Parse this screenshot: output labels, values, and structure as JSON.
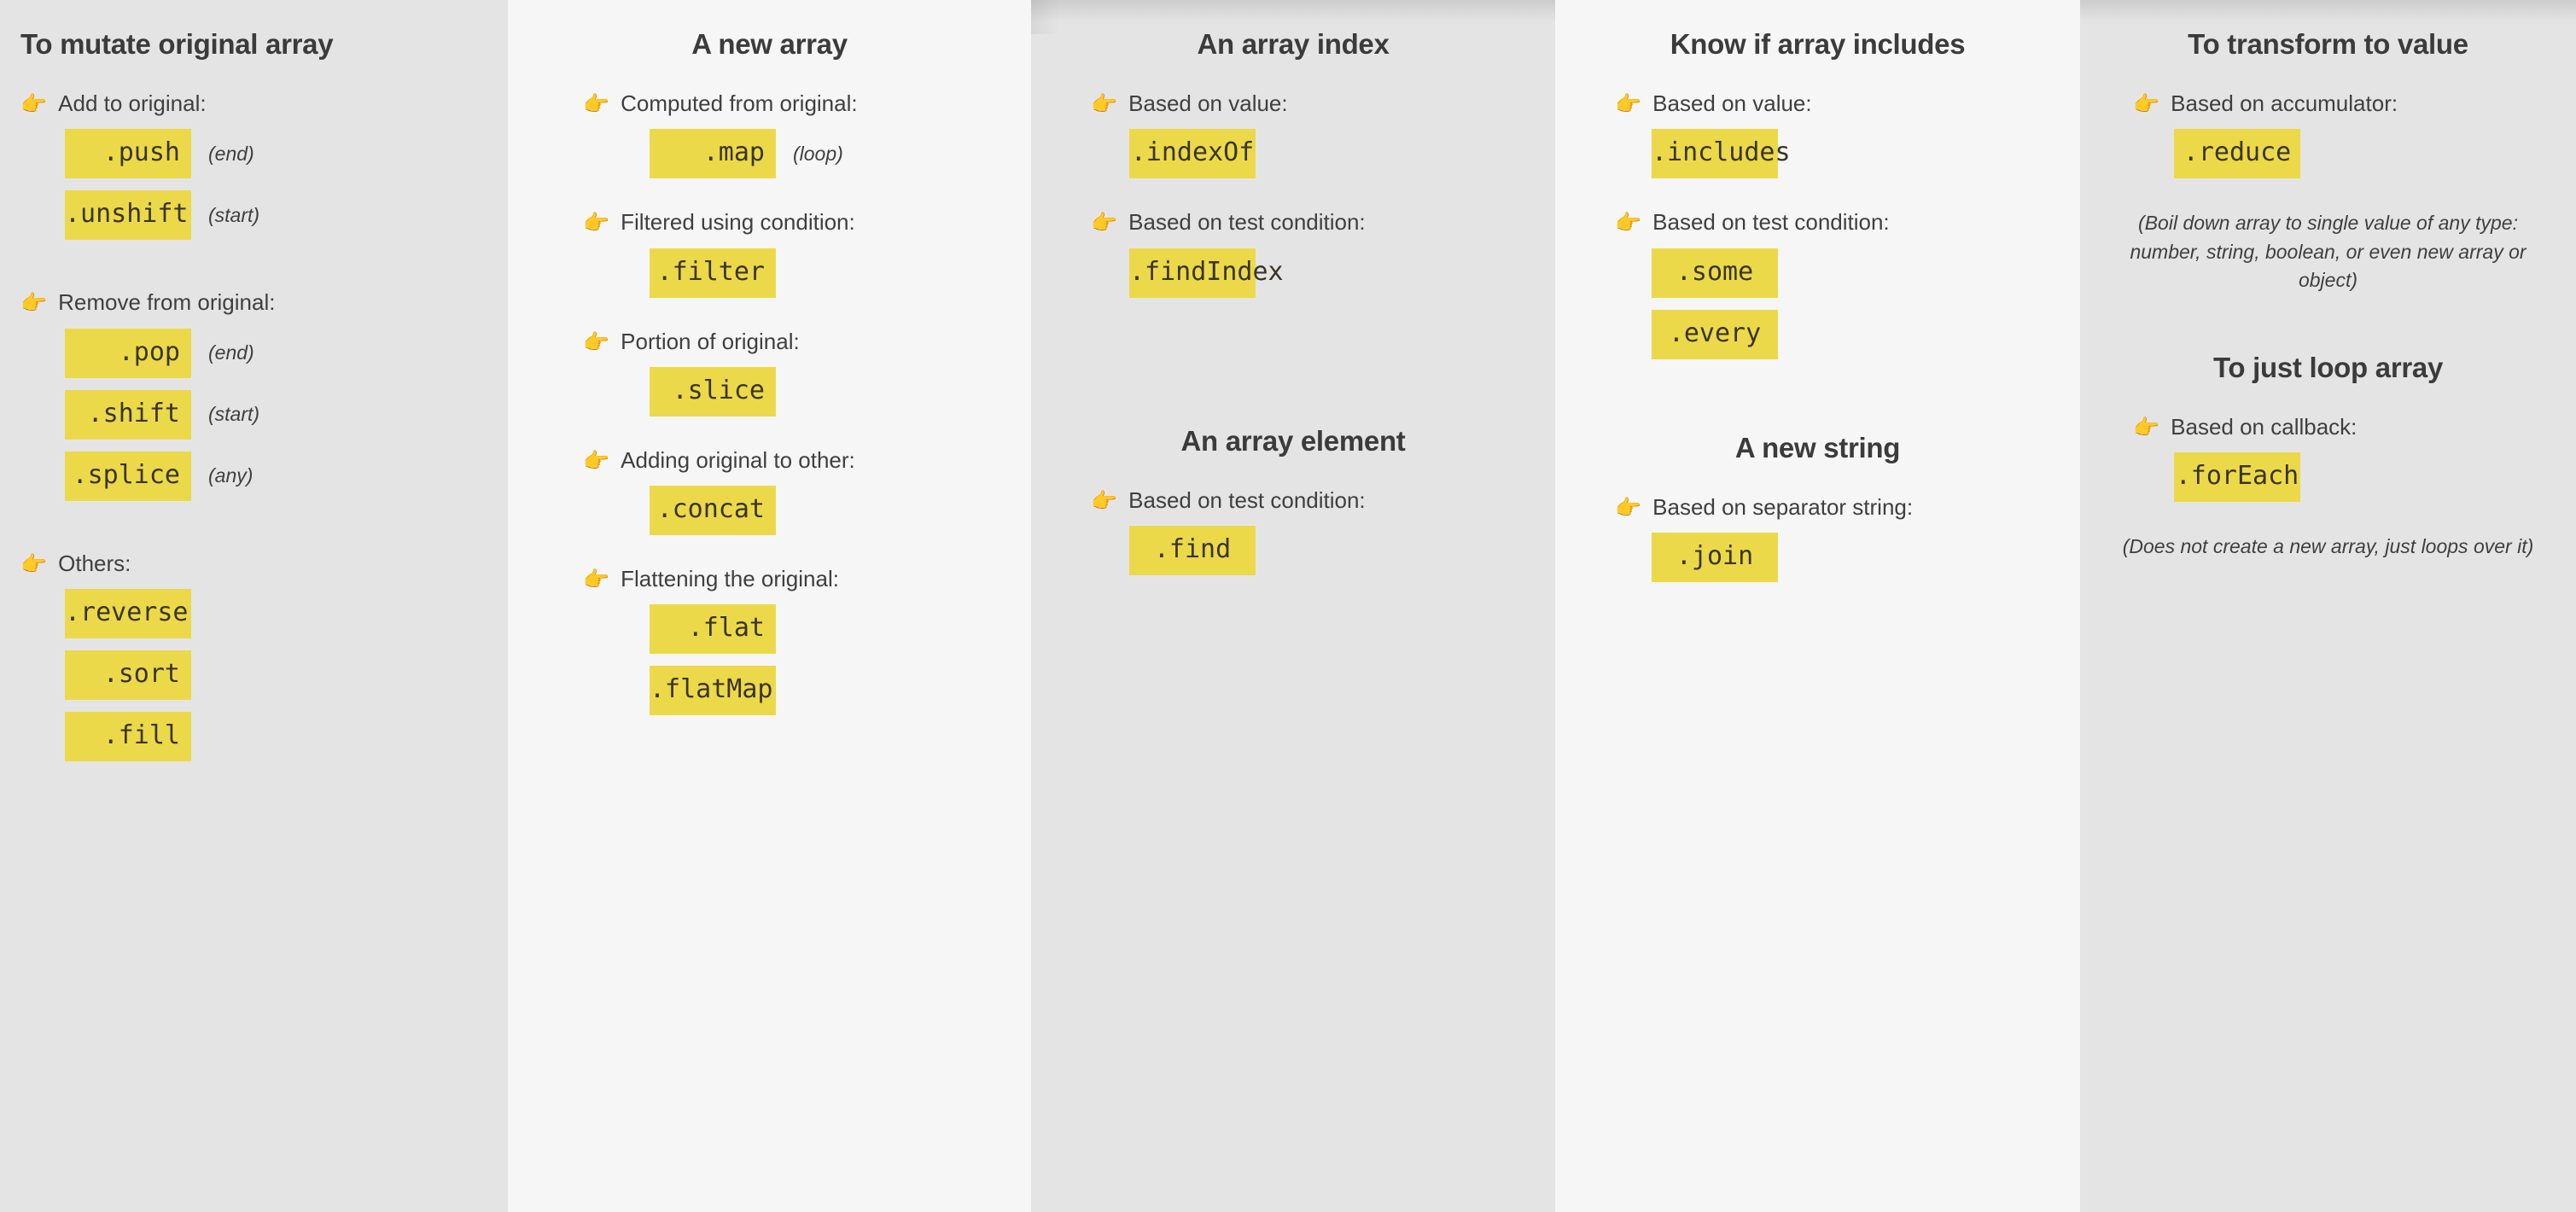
{
  "icons": {
    "hand_pointer": "👉"
  },
  "colors": {
    "panel_dark": "#e5e4e4",
    "panel_light": "#f6f6f6",
    "chip_yellow": "#ecd94a",
    "text_dark": "#3b3b3b"
  },
  "columns": [
    {
      "heading": "To mutate original array",
      "groups": [
        {
          "label": "Add to original:",
          "chips": [
            {
              "name": ".push",
              "note": "(end)"
            },
            {
              "name": ".unshift",
              "note": "(start)"
            }
          ]
        },
        {
          "label": "Remove from original:",
          "chips": [
            {
              "name": ".pop",
              "note": "(end)"
            },
            {
              "name": ".shift",
              "note": "(start)"
            },
            {
              "name": ".splice",
              "note": "(any)"
            }
          ]
        },
        {
          "label": "Others:",
          "chips": [
            {
              "name": ".reverse",
              "note": ""
            },
            {
              "name": ".sort",
              "note": ""
            },
            {
              "name": ".fill",
              "note": ""
            }
          ]
        }
      ]
    },
    {
      "heading": "A new array",
      "groups": [
        {
          "label": "Computed from original:",
          "chips": [
            {
              "name": ".map",
              "note": "(loop)"
            }
          ]
        },
        {
          "label": "Filtered using condition:",
          "chips": [
            {
              "name": ".filter",
              "note": ""
            }
          ]
        },
        {
          "label": "Portion of original:",
          "chips": [
            {
              "name": ".slice",
              "note": ""
            }
          ]
        },
        {
          "label": "Adding original to other:",
          "chips": [
            {
              "name": ".concat",
              "note": ""
            }
          ]
        },
        {
          "label": "Flattening the original:",
          "chips": [
            {
              "name": ".flat",
              "note": ""
            },
            {
              "name": ".flatMap",
              "note": ""
            }
          ]
        }
      ]
    },
    {
      "heading": "An array index",
      "groups": [
        {
          "label": "Based on value:",
          "chips": [
            {
              "name": ".indexOf",
              "note": ""
            }
          ]
        },
        {
          "label": "Based on test condition:",
          "chips": [
            {
              "name": ".findIndex",
              "note": ""
            }
          ]
        }
      ],
      "heading2": "An array element",
      "groups2": [
        {
          "label": "Based on test condition:",
          "chips": [
            {
              "name": ".find",
              "note": ""
            }
          ]
        }
      ]
    },
    {
      "heading": "Know if array includes",
      "groups": [
        {
          "label": "Based on value:",
          "chips": [
            {
              "name": ".includes",
              "note": ""
            }
          ]
        },
        {
          "label": "Based on test condition:",
          "chips": [
            {
              "name": ".some",
              "note": ""
            },
            {
              "name": ".every",
              "note": ""
            }
          ]
        }
      ],
      "heading2": "A new string",
      "groups2": [
        {
          "label": "Based on separator string:",
          "chips": [
            {
              "name": ".join",
              "note": ""
            }
          ]
        }
      ]
    },
    {
      "heading": "To transform to value",
      "groups": [
        {
          "label": "Based on accumulator:",
          "chips": [
            {
              "name": ".reduce",
              "note": ""
            }
          ]
        }
      ],
      "note": "(Boil down array to single value of any type: number, string, boolean, or even new array or object)",
      "heading2": "To just loop array",
      "groups2": [
        {
          "label": "Based on callback:",
          "chips": [
            {
              "name": ".forEach",
              "note": ""
            }
          ]
        }
      ],
      "note2": "(Does not create a new array, just loops over it)"
    }
  ]
}
